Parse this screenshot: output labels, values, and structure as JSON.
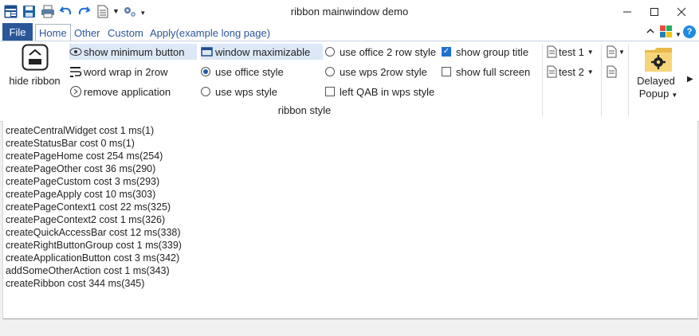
{
  "window": {
    "title": "ribbon mainwindow demo"
  },
  "tabs": {
    "file": "File",
    "home": "Home",
    "other": "Other",
    "custom": "Custom",
    "apply": "Apply(example long page)"
  },
  "ribbon": {
    "hide_ribbon_label": "hide ribbon",
    "show_min_button": "show minimum button",
    "word_wrap": "word wrap in 2row",
    "remove_app": "remove application",
    "window_maximizable": "window maximizable",
    "use_office_style": "use office style",
    "use_wps_style": "use wps style",
    "use_office_2row": "use office 2 row style",
    "use_wps_2row": "use wps 2row style",
    "left_qab_wps": "left QAB in wps style",
    "show_group_title": "show group title",
    "show_full_screen": "show full screen",
    "group_title": "ribbon style",
    "test1": "test 1",
    "test2": "test 2",
    "delayed": "Delayed",
    "popup": "Popup",
    "states": {
      "use_office_style": true,
      "show_group_title": true
    }
  },
  "log": [
    "createCentralWidget cost 1 ms(1)",
    "createStatusBar cost 0 ms(1)",
    "createPageHome cost 254 ms(254)",
    "createPageOther cost 36 ms(290)",
    "createPageCustom cost 3 ms(293)",
    "createPageApply cost 10 ms(303)",
    "createPageContext1 cost 22 ms(325)",
    "createPageContext2 cost 1 ms(326)",
    "createQuickAccessBar cost 12 ms(338)",
    "createRightButtonGroup cost 1 ms(339)",
    "createApplicationButton cost 3 ms(342)",
    "addSomeOtherAction cost 1 ms(343)",
    "createRibbon cost 344 ms(345)"
  ],
  "colors": {
    "accent": "#2b579a",
    "highlight": "#dce8f6"
  }
}
